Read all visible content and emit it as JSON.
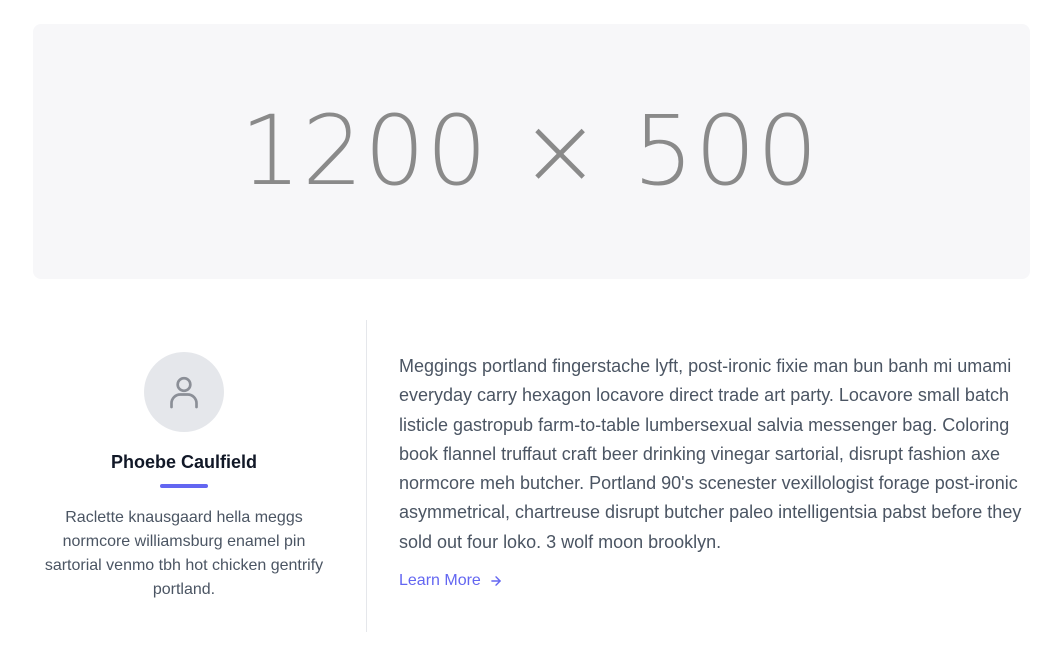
{
  "hero": {
    "placeholder_text": "1200 × 500"
  },
  "profile": {
    "avatar_icon": "user-icon",
    "name": "Phoebe Caulfield",
    "bio": "Raclette knausgaard hella meggs normcore williamsburg enamel pin sartorial venmo tbh hot chicken gentrify portland."
  },
  "article": {
    "paragraph": "Meggings portland fingerstache lyft, post-ironic fixie man bun banh mi umami everyday carry hexagon locavore direct trade art party. Locavore small batch listicle gastropub farm-to-table lumbersexual salvia messenger bag. Coloring book flannel truffaut craft beer drinking vinegar sartorial, disrupt fashion axe normcore meh butcher. Portland 90's scenester vexillologist forage post-ironic asymmetrical, chartreuse disrupt butcher paleo intelligentsia pabst before they sold out four loko. 3 wolf moon brooklyn.",
    "learn_more_label": "Learn More",
    "learn_more_icon": "arrow-right-icon"
  },
  "colors": {
    "accent": "#6366f1",
    "avatar_bg": "#e5e7eb",
    "hero_bg": "#f7f7f9",
    "text_muted": "#4b5563",
    "heading": "#111827"
  }
}
